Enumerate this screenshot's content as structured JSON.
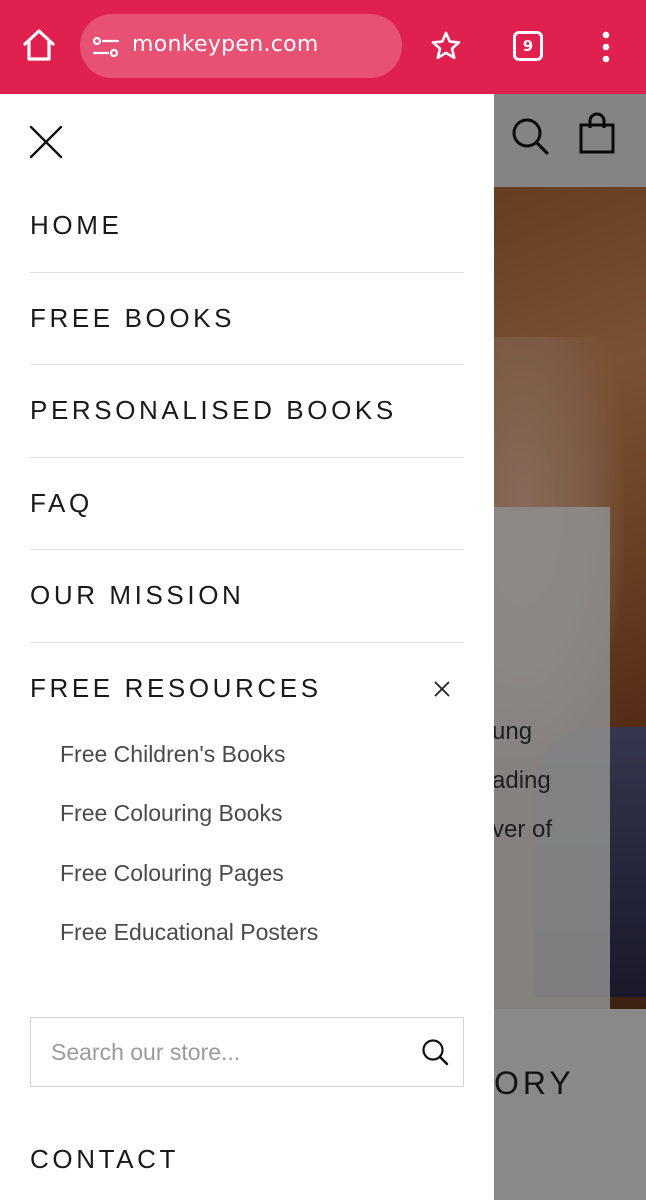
{
  "browser": {
    "url": "monkeypen.com",
    "tab_count": "9",
    "accent_color": "#e0204e",
    "icons": [
      "home-icon",
      "site-settings-icon",
      "bookmark-star-icon",
      "tab-switcher-icon",
      "more-vert-icon"
    ]
  },
  "background_page": {
    "hero_text_lines": [
      "ung",
      "ading",
      "ver of"
    ],
    "section_heading_fragment": "ORY",
    "icons": [
      "search-icon",
      "shopping-bag-icon"
    ]
  },
  "drawer": {
    "close_icon": "close-icon",
    "nav_items": [
      {
        "label": "HOME"
      },
      {
        "label": "FREE BOOKS"
      },
      {
        "label": "PERSONALISED BOOKS"
      },
      {
        "label": "FAQ"
      },
      {
        "label": "OUR MISSION"
      }
    ],
    "resources": {
      "label": "FREE RESOURCES",
      "expanded": true,
      "items": [
        {
          "label": "Free Children's Books"
        },
        {
          "label": "Free Colouring Books"
        },
        {
          "label": "Free Colouring Pages"
        },
        {
          "label": "Free Educational Posters"
        }
      ]
    },
    "search": {
      "placeholder": "Search our store...",
      "value": ""
    },
    "contact_label": "CONTACT"
  }
}
